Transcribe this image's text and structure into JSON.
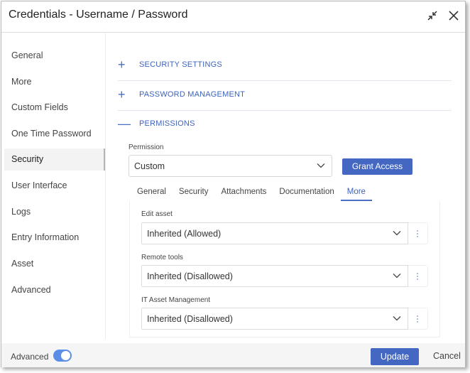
{
  "header": {
    "title": "Credentials - Username / Password",
    "icons": [
      "collapse-icon",
      "close-icon"
    ]
  },
  "sidebar": {
    "items": [
      {
        "label": "General"
      },
      {
        "label": "More"
      },
      {
        "label": "Custom Fields"
      },
      {
        "label": "One Time Password"
      },
      {
        "label": "Security",
        "active": true
      },
      {
        "label": "User Interface"
      },
      {
        "label": "Logs"
      },
      {
        "label": "Entry Information"
      },
      {
        "label": "Asset"
      },
      {
        "label": "Advanced"
      }
    ]
  },
  "sections": [
    {
      "label": "SECURITY SETTINGS",
      "symbol": "+",
      "expanded": false
    },
    {
      "label": "PASSWORD MANAGEMENT",
      "symbol": "+",
      "expanded": false
    },
    {
      "label": "PERMISSIONS",
      "symbol": "—",
      "expanded": true
    }
  ],
  "permissions": {
    "permission_label": "Permission",
    "permission_value": "Custom",
    "grant_button": "Grant Access",
    "tabs": [
      {
        "label": "General"
      },
      {
        "label": "Security"
      },
      {
        "label": "Attachments"
      },
      {
        "label": "Documentation"
      },
      {
        "label": "More",
        "active": true
      }
    ],
    "fields": [
      {
        "label": "Edit asset",
        "value": "Inherited (Allowed)"
      },
      {
        "label": "Remote tools",
        "value": "Inherited (Disallowed)"
      },
      {
        "label": "IT Asset Management",
        "value": "Inherited (Disallowed)"
      }
    ]
  },
  "footer": {
    "advanced_label": "Advanced",
    "advanced_on": true,
    "update_button": "Update",
    "cancel_button": "Cancel"
  },
  "colors": {
    "accent": "#4467c2",
    "section_text": "#3d63c0",
    "toggle_on": "#5b8ee6"
  }
}
